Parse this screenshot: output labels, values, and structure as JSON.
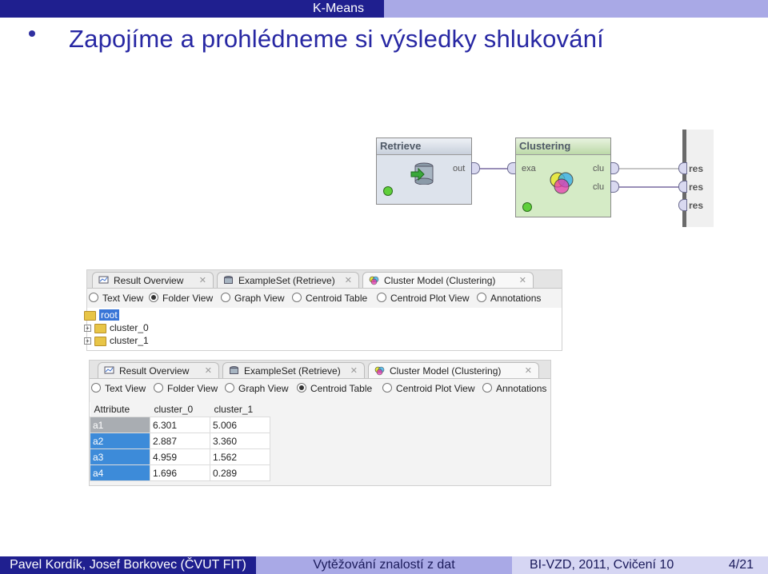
{
  "header": {
    "title": "K-Means"
  },
  "slide": {
    "heading": "Zapojíme a prohlédneme si výsledky shlukování"
  },
  "process": {
    "retrieve": {
      "title": "Retrieve",
      "out_port": "out"
    },
    "clustering": {
      "title": "Clustering",
      "in_port": "exa",
      "out_port_1": "clu",
      "out_port_2": "clu"
    },
    "results": [
      "res",
      "res",
      "res"
    ]
  },
  "panel1": {
    "tabs": [
      "Result Overview",
      "ExampleSet (Retrieve)",
      "Cluster Model (Clustering)"
    ],
    "views": [
      "Text View",
      "Folder View",
      "Graph View",
      "Centroid Table",
      "Centroid Plot View",
      "Annotations"
    ],
    "selected_view": "Folder View",
    "tree": {
      "root": "root",
      "children": [
        "cluster_0",
        "cluster_1"
      ]
    }
  },
  "panel2": {
    "tabs": [
      "Result Overview",
      "ExampleSet (Retrieve)",
      "Cluster Model (Clustering)"
    ],
    "views": [
      "Text View",
      "Folder View",
      "Graph View",
      "Centroid Table",
      "Centroid Plot View",
      "Annotations"
    ],
    "selected_view": "Centroid Table",
    "table": {
      "columns": [
        "Attribute",
        "cluster_0",
        "cluster_1"
      ],
      "rows": [
        [
          "a1",
          "6.301",
          "5.006"
        ],
        [
          "a2",
          "2.887",
          "3.360"
        ],
        [
          "a3",
          "4.959",
          "1.562"
        ],
        [
          "a4",
          "1.696",
          "0.289"
        ]
      ]
    }
  },
  "footer": {
    "authors": "Pavel Kordík, Josef Borkovec (ČVUT FIT)",
    "course_title": "Vytěžování znalostí z dat",
    "lecture": "BI-VZD, 2011, Cvičení 10",
    "page": "4/21"
  },
  "colors": {
    "title_blue": "#2727a3",
    "dark_bar": "#1f1f8f",
    "light_bar": "#a9a9e6",
    "selection": "#3d8bd9"
  }
}
